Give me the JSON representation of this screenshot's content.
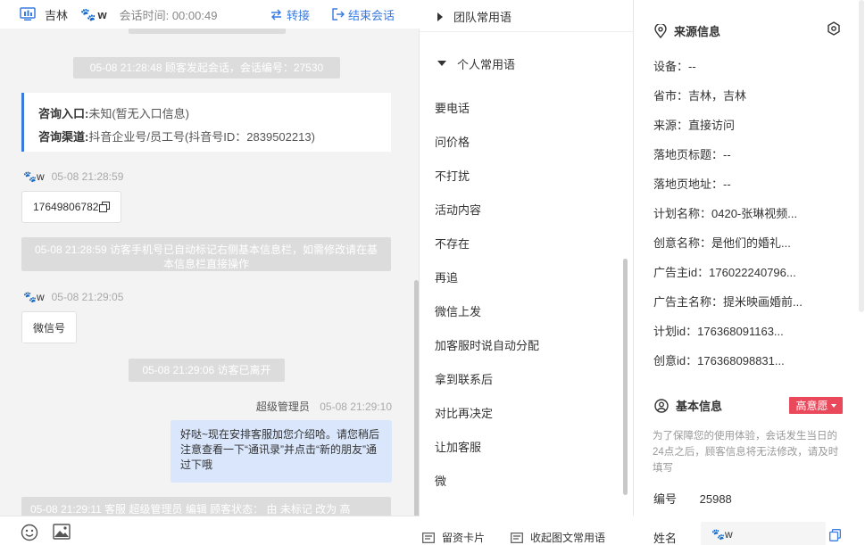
{
  "header": {
    "city": "吉林",
    "visitor_name": "w",
    "session_label": "会话时间:",
    "session_time": "00:00:49",
    "transfer_label": "转接",
    "end_label": "结束会话"
  },
  "chat": {
    "sys_start": "05-08 21:28:48 顾客发起会话，会话编号：27530",
    "entry": {
      "label1": "咨询入口:",
      "value1": "未知(暂无入口信息)",
      "label2": "咨询渠道:",
      "value2": "抖音企业号/员工号(抖音号ID：2839502213)"
    },
    "msg1": {
      "name": "w",
      "time": "05-08 21:28:59",
      "text": "17649806782"
    },
    "sys_phone": "05-08 21:28:59 访客手机号已自动标记右侧基本信息栏，如需修改请在基本信息栏直接操作",
    "msg2": {
      "name": "w",
      "time": "05-08 21:29:05",
      "text": "微信号"
    },
    "sys_left": "05-08 21:29:06 访客已离开",
    "agent_msg": {
      "name": "超级管理员",
      "time": "05-08 21:29:10",
      "text": "好哒~现在安排客服加您介绍哈。请您稍后注意查看一下“通讯录”并点击“新的朋友”通过下哦"
    },
    "sys_last": "05-08 21:29:11 客服 超级管理员 编辑 顾客状态： 由 未标记 改为 高"
  },
  "phrases": {
    "team_group": "团队常用语",
    "mine_group": "个人常用语",
    "items": [
      "要电话",
      "问价格",
      "不打扰",
      "活动内容",
      "不存在",
      "再追",
      "微信上发",
      "加客服时说自动分配",
      "拿到联系后",
      "对比再决定",
      "让加客服",
      "微"
    ],
    "footer_card": "留资卡片",
    "footer_collapse": "收起图文常用语"
  },
  "info": {
    "source_title": "来源信息",
    "rows": [
      {
        "label": "设备：",
        "value": "--"
      },
      {
        "label": "省市：",
        "value": "吉林，吉林"
      },
      {
        "label": "来源：",
        "value": "直接访问"
      },
      {
        "label": "落地页标题：",
        "value": "--"
      },
      {
        "label": "落地页地址：",
        "value": "--"
      },
      {
        "label": "计划名称：",
        "value": "0420-张琳视频..."
      },
      {
        "label": "创意名称：",
        "value": "是他们的婚礼..."
      },
      {
        "label": "广告主id：",
        "value": "176022240796..."
      },
      {
        "label": "广告主名称：",
        "value": "提米映画婚前..."
      },
      {
        "label": "计划id：",
        "value": "176368091163..."
      },
      {
        "label": "创意id：",
        "value": "176368098831..."
      }
    ],
    "basic_title": "基本信息",
    "intent_tag": "高意愿",
    "hint": "为了保障您的使用体验，会话发生当日的24点之后，顾客信息将无法修改，请及时填写",
    "id_label": "编号",
    "id_value": "25988",
    "name_label": "姓名",
    "name_value": "w"
  },
  "colors": {
    "accent": "#3a7be0",
    "agent_bubble": "#d9e6fb",
    "tag_red": "#e9495a",
    "system_gray": "#dcdcdc"
  }
}
